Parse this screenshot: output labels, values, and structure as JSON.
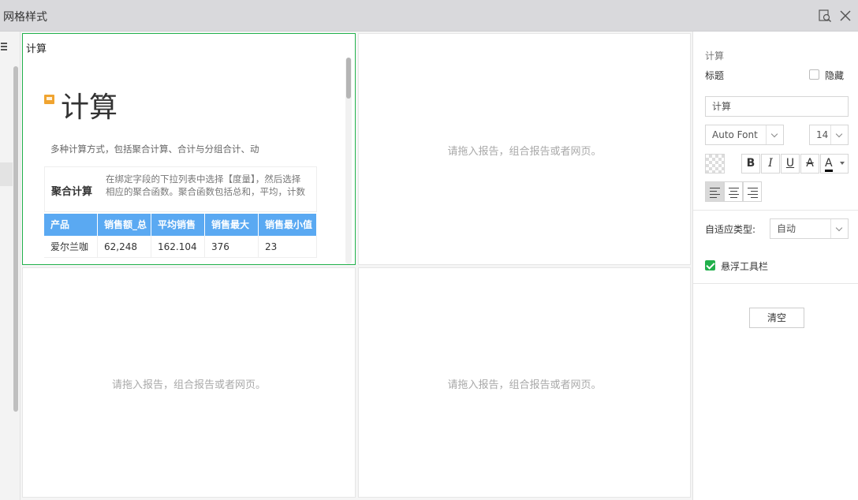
{
  "window": {
    "title": "网格样式"
  },
  "grid": {
    "placeholder": "请拖入报告，组合报告或者网页。",
    "active_cell": {
      "title": "计算",
      "big_title": "计算",
      "description": "多种计算方式，包括聚合计算、合计与分组合计、动",
      "summary": {
        "label": "聚合计算",
        "text_line1": "在绑定字段的下拉列表中选择【度量】，然后选择",
        "text_line2": "相应的聚合函数。聚合函数包括总和，平均，计数"
      },
      "table": {
        "headers": [
          "产品",
          "销售额_总",
          "平均销售",
          "销售最大",
          "销售最小值"
        ],
        "rows": [
          [
            "爱尔兰咖",
            "62,248",
            "162.104",
            "376",
            "23"
          ]
        ]
      }
    }
  },
  "panel": {
    "section_label": "计算",
    "title_label": "标题",
    "hide_label": "隐藏",
    "hide_checked": false,
    "title_value": "计算",
    "font_family": "Auto Font",
    "font_size": "14",
    "bold": "B",
    "italic": "I",
    "underline": "U",
    "strike": "A",
    "font_color_glyph": "A",
    "font_color": "#000000",
    "adapt_label": "自适应类型:",
    "adapt_value": "自动",
    "float_toolbar_label": "悬浮工具栏",
    "float_toolbar_checked": true,
    "clear_label": "清空"
  },
  "colors": {
    "active_border": "#22b14c",
    "table_header": "#5aa9f2",
    "checkbox_green": "#21b04b"
  }
}
